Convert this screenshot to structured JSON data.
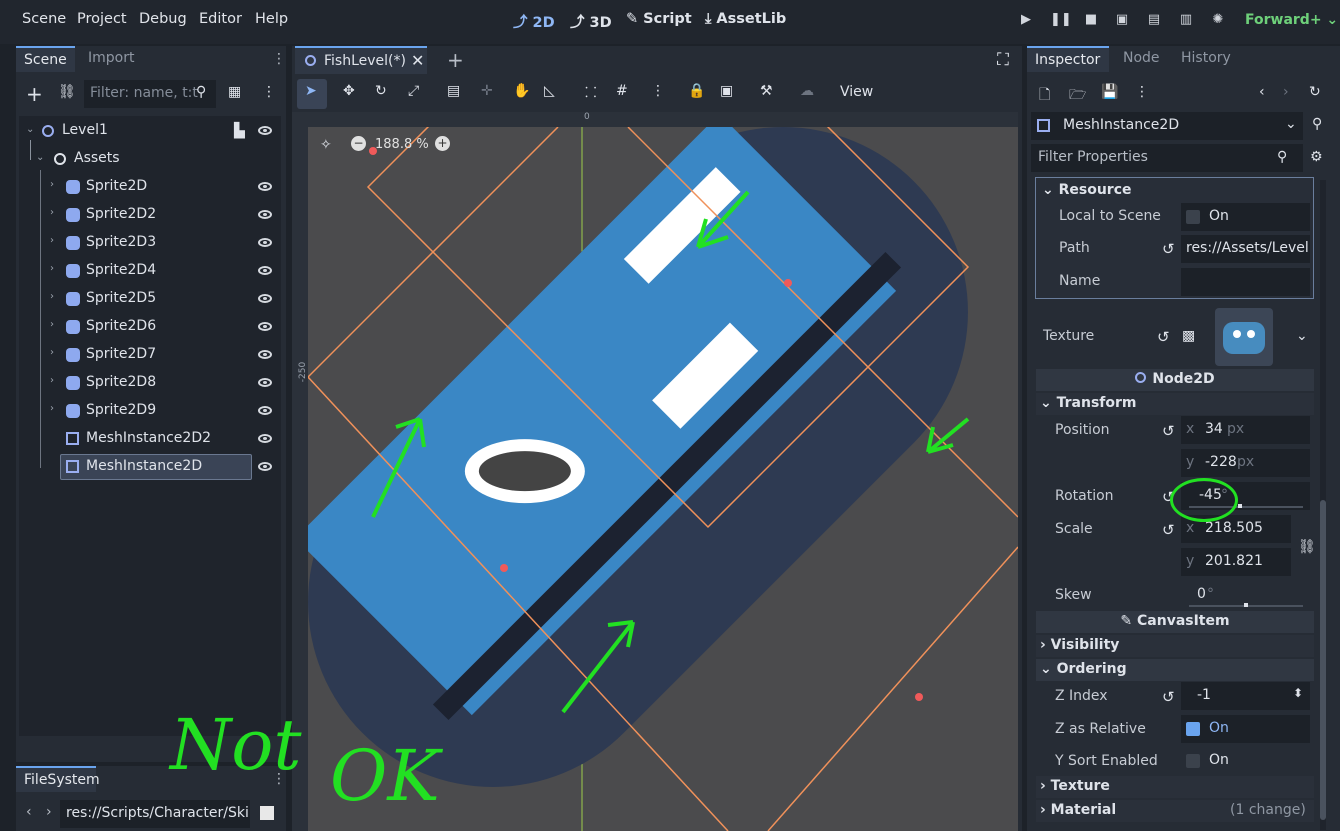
{
  "menu": {
    "items": [
      "Scene",
      "Project",
      "Debug",
      "Editor",
      "Help"
    ]
  },
  "workspaces": {
    "d2": "2D",
    "d3": "3D",
    "script": "Script",
    "assetlib": "AssetLib"
  },
  "renderer": "Forward+",
  "scene_dock": {
    "tab_scene": "Scene",
    "tab_import": "Import",
    "filter_placeholder": "Filter: name, t:t",
    "tree": [
      "Level1",
      "Assets",
      "Sprite2D",
      "Sprite2D2",
      "Sprite2D3",
      "Sprite2D4",
      "Sprite2D5",
      "Sprite2D6",
      "Sprite2D7",
      "Sprite2D8",
      "Sprite2D9",
      "MeshInstance2D2",
      "MeshInstance2D"
    ]
  },
  "filesystem": {
    "tab": "FileSystem",
    "path": "res://Scripts/Character/Skill"
  },
  "editor": {
    "tab_title": "FishLevel(*)",
    "zoom": "188.8 %",
    "view": "View",
    "ruler_zero": "0",
    "ruler_side": "-250"
  },
  "inspector": {
    "tab_inspector": "Inspector",
    "tab_node": "Node",
    "tab_history": "History",
    "node_type": "MeshInstance2D",
    "filter_placeholder": "Filter Properties",
    "resource": {
      "header": "Resource",
      "local_to_scene": "Local to Scene",
      "local_value": "On",
      "path_label": "Path",
      "path_value": "res://Assets/Level",
      "name_label": "Name"
    },
    "texture_label": "Texture",
    "node2d": "Node2D",
    "transform": "Transform",
    "position_label": "Position",
    "pos_x": "34",
    "pos_y": "-228",
    "px": "px",
    "rotation_label": "Rotation",
    "rotation_value": "-45",
    "deg": "°",
    "scale_label": "Scale",
    "scale_x": "218.505",
    "scale_y": "201.821",
    "skew_label": "Skew",
    "skew_value": "0",
    "canvasitem": "CanvasItem",
    "visibility": "Visibility",
    "ordering": "Ordering",
    "zindex_label": "Z Index",
    "zindex_value": "-1",
    "zrel_label": "Z as Relative",
    "zrel_value": "On",
    "ysort_label": "Y Sort Enabled",
    "ysort_value": "On",
    "texture_sect": "Texture",
    "material_sect": "Material",
    "material_changes": "(1 change)",
    "axis_x": "x",
    "axis_y": "y"
  },
  "annotation": {
    "text_not": "Not",
    "text_ok": "OK"
  },
  "colors": {
    "accent": "#6aa4ee",
    "annotation": "#22e022",
    "selection_box": "#f0915a"
  }
}
